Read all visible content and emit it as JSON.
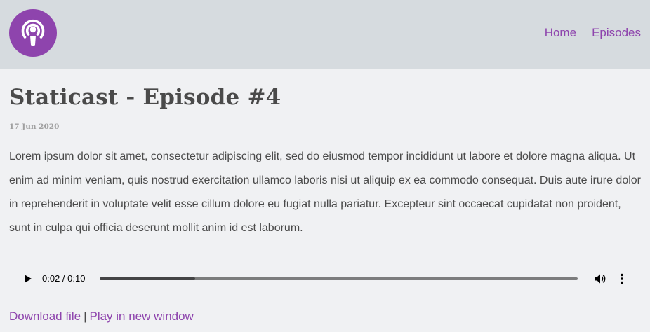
{
  "header": {
    "logo_icon": "podcast-icon",
    "nav": [
      {
        "label": "Home"
      },
      {
        "label": "Episodes"
      }
    ]
  },
  "article": {
    "title": "Staticast - Episode #4",
    "date": "17 Jun 2020",
    "body": "Lorem ipsum dolor sit amet, consectetur adipiscing elit, sed do eiusmod tempor incididunt ut labore et dolore magna aliqua. Ut enim ad minim veniam, quis nostrud exercitation ullamco laboris nisi ut aliquip ex ea commodo consequat. Duis aute irure dolor in reprehenderit in voluptate velit esse cillum dolore eu fugiat nulla pariatur. Excepteur sint occaecat cupidatat non proident, sunt in culpa qui officia deserunt mollit anim id est laborum."
  },
  "player": {
    "time": "0:02 / 0:10",
    "progress": 0.2,
    "play_icon": "play-icon",
    "volume_icon": "volume-icon",
    "more_icon": "more-vertical-icon"
  },
  "links": {
    "download": "Download file",
    "separator": "|",
    "play_new_window": "Play in new window"
  },
  "colors": {
    "accent": "#8e44ad",
    "header_bg": "#d6dbdf",
    "page_bg": "#f0f1f3",
    "text": "#4a4a4a"
  }
}
